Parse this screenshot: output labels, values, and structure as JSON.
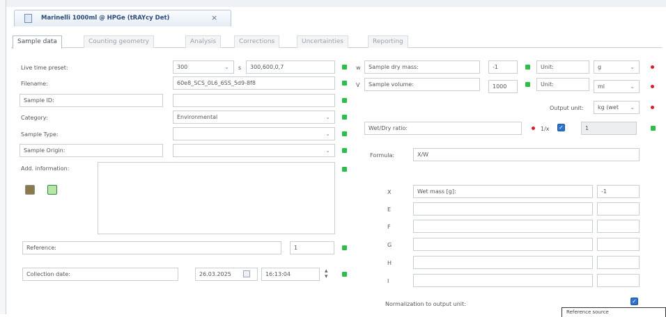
{
  "document_tab": {
    "title": "Marinelli 1000ml @ HPGe (tRAYcy Det)",
    "close": "×"
  },
  "tabs": [
    "Sample data",
    "Counting geometry",
    "Analysis",
    "Corrections",
    "Uncertainties",
    "Reporting"
  ],
  "live_time": {
    "label": "Live time preset:",
    "value": "300",
    "unit": "s",
    "alt": "300,600,0,7"
  },
  "filename": {
    "label": "Filename:",
    "value": "60e8_SCS_0L6_6SS_5d9-8f8"
  },
  "sample_id": {
    "label": "Sample ID:",
    "value": ""
  },
  "category": {
    "label": "Category:",
    "value": "Environmental"
  },
  "sample_type": {
    "label": "Sample Type:",
    "value": ""
  },
  "sample_origin": {
    "label": "Sample Origin:",
    "value": ""
  },
  "addl_info": {
    "label": "Add. information:",
    "value": ""
  },
  "reference": {
    "label": "Reference:",
    "value": "1"
  },
  "collection_date": {
    "label": "Collection date:",
    "date": "26.03.2025",
    "time": "16:13:04"
  },
  "dry_mass": {
    "prefix": "w",
    "label": "Sample dry mass:",
    "value": "-1",
    "unit_label": "Unit:",
    "unit": "g"
  },
  "volume": {
    "prefix": "V",
    "label": "Sample volume:",
    "value": "1000",
    "unit_label": "Unit:",
    "unit": "ml"
  },
  "output_unit": {
    "label": "Output unit:",
    "value": "kg (wet"
  },
  "wet_dry": {
    "label": "Wet/Dry ratio:",
    "toggle": "1/x",
    "value": "1"
  },
  "formula": {
    "label": "Formula:",
    "value": "X/W"
  },
  "variables": [
    {
      "name": "X",
      "desc": "Wet mass [g]:",
      "value": "-1"
    },
    {
      "name": "E",
      "desc": "",
      "value": ""
    },
    {
      "name": "F",
      "desc": "",
      "value": ""
    },
    {
      "name": "G",
      "desc": "",
      "value": ""
    },
    {
      "name": "H",
      "desc": "",
      "value": ""
    },
    {
      "name": "I",
      "desc": "",
      "value": ""
    }
  ],
  "normalization": {
    "label": "Normalization to output unit:",
    "checked": true
  },
  "popup": {
    "text": "Reference source"
  },
  "colors": {
    "green": "#2bbf4a",
    "red": "#d81e2a",
    "blue": "#2f73c8"
  },
  "icons": [
    "document-icon",
    "close-icon",
    "import-icon",
    "add-icon",
    "calendar-icon",
    "spin-icon"
  ]
}
